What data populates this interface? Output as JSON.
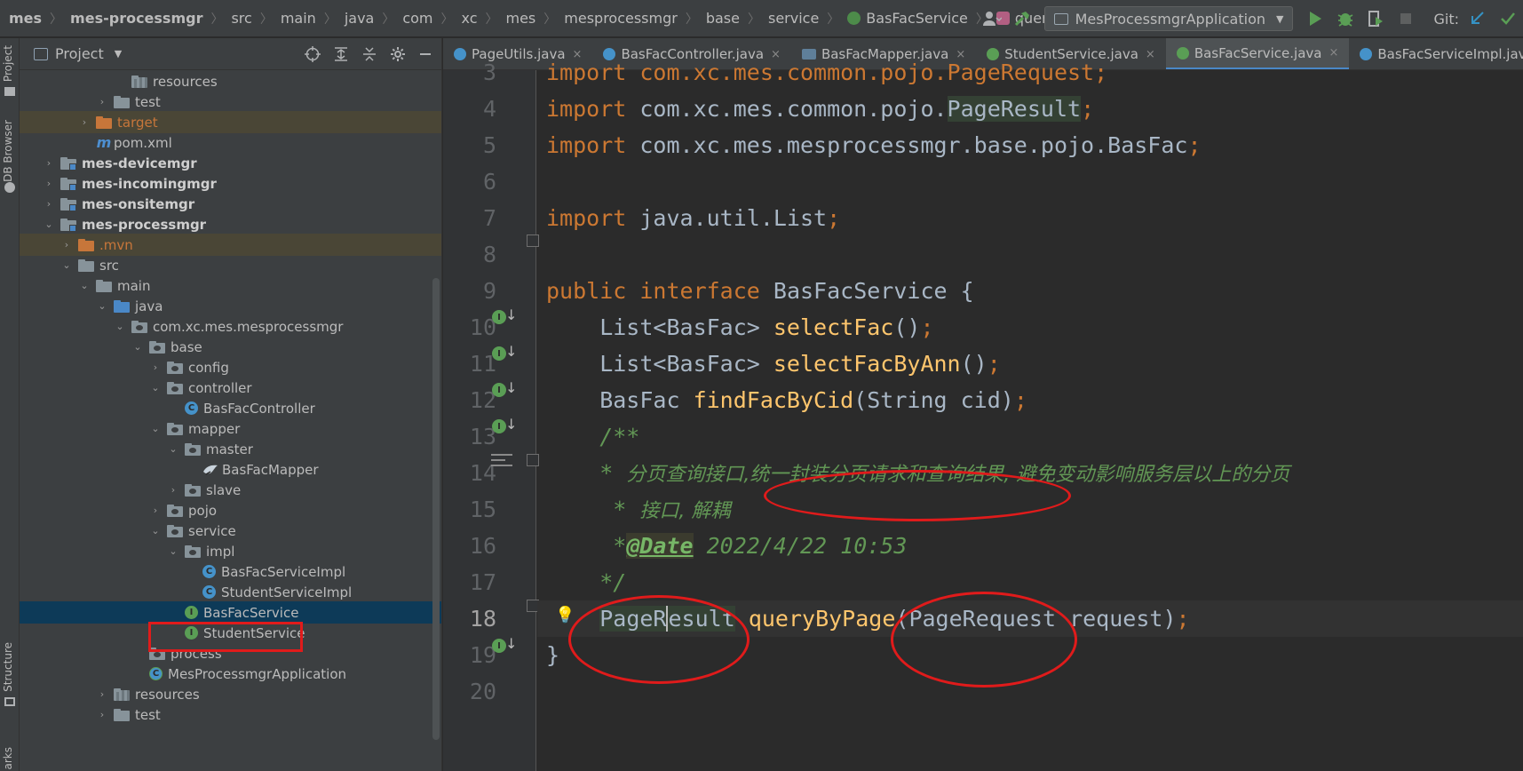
{
  "breadcrumb": [
    "mes",
    "mes-processmgr",
    "src",
    "main",
    "java",
    "com",
    "xc",
    "mes",
    "mesprocessmgr",
    "base",
    "service",
    "BasFacService",
    "queryByPage"
  ],
  "toolbar": {
    "run_config": "MesProcessmgrApplication",
    "git_label": "Git:"
  },
  "left_strip": {
    "project_tab": "Project",
    "db_browser_tab": "DB Browser",
    "structure_tab": "Structure",
    "bookmarks_tab": "arks"
  },
  "project_panel": {
    "title": "Project",
    "tree": [
      {
        "label": "resources",
        "indent": 5,
        "type": "res",
        "arrow": ""
      },
      {
        "label": "test",
        "indent": 4,
        "type": "folder",
        "arrow": "›"
      },
      {
        "label": "target",
        "indent": 3,
        "type": "orange",
        "arrow": "›",
        "highlight": "brown"
      },
      {
        "label": "pom.xml",
        "indent": 3,
        "type": "maven",
        "arrow": ""
      },
      {
        "label": "mes-devicemgr",
        "indent": 1,
        "type": "module",
        "arrow": "›",
        "bold": true
      },
      {
        "label": "mes-incomingmgr",
        "indent": 1,
        "type": "module",
        "arrow": "›",
        "bold": true
      },
      {
        "label": "mes-onsitemgr",
        "indent": 1,
        "type": "module",
        "arrow": "›",
        "bold": true
      },
      {
        "label": "mes-processmgr",
        "indent": 1,
        "type": "module",
        "arrow": "⌄",
        "bold": true
      },
      {
        "label": ".mvn",
        "indent": 2,
        "type": "orange",
        "arrow": "›",
        "highlight": "brown"
      },
      {
        "label": "src",
        "indent": 2,
        "type": "folder",
        "arrow": "⌄"
      },
      {
        "label": "main",
        "indent": 3,
        "type": "folder",
        "arrow": "⌄"
      },
      {
        "label": "java",
        "indent": 4,
        "type": "blue",
        "arrow": "⌄"
      },
      {
        "label": "com.xc.mes.mesprocessmgr",
        "indent": 5,
        "type": "pkg",
        "arrow": "⌄"
      },
      {
        "label": "base",
        "indent": 6,
        "type": "pkg",
        "arrow": "⌄"
      },
      {
        "label": "config",
        "indent": 7,
        "type": "pkg",
        "arrow": "›"
      },
      {
        "label": "controller",
        "indent": 7,
        "type": "pkg",
        "arrow": "⌄"
      },
      {
        "label": "BasFacController",
        "indent": 8,
        "type": "class",
        "arrow": ""
      },
      {
        "label": "mapper",
        "indent": 7,
        "type": "pkg",
        "arrow": "⌄"
      },
      {
        "label": "master",
        "indent": 8,
        "type": "pkg",
        "arrow": "⌄"
      },
      {
        "label": "BasFacMapper",
        "indent": 9,
        "type": "mapper",
        "arrow": ""
      },
      {
        "label": "slave",
        "indent": 8,
        "type": "pkg",
        "arrow": "›"
      },
      {
        "label": "pojo",
        "indent": 7,
        "type": "pkg",
        "arrow": "›"
      },
      {
        "label": "service",
        "indent": 7,
        "type": "pkg",
        "arrow": "⌄"
      },
      {
        "label": "impl",
        "indent": 8,
        "type": "pkg",
        "arrow": "⌄"
      },
      {
        "label": "BasFacServiceImpl",
        "indent": 9,
        "type": "class",
        "arrow": ""
      },
      {
        "label": "StudentServiceImpl",
        "indent": 9,
        "type": "class",
        "arrow": ""
      },
      {
        "label": "BasFacService",
        "indent": 8,
        "type": "interface",
        "arrow": "",
        "selected": true
      },
      {
        "label": "StudentService",
        "indent": 8,
        "type": "interface",
        "arrow": ""
      },
      {
        "label": "process",
        "indent": 6,
        "type": "pkg",
        "arrow": ""
      },
      {
        "label": "MesProcessmgrApplication",
        "indent": 6,
        "type": "app",
        "arrow": ""
      },
      {
        "label": "resources",
        "indent": 4,
        "type": "res",
        "arrow": "›"
      },
      {
        "label": "test",
        "indent": 4,
        "type": "folder",
        "arrow": "›"
      }
    ]
  },
  "tabs": [
    {
      "label": "PageUtils.java",
      "icon": "class-icon",
      "active": false
    },
    {
      "label": "BasFacController.java",
      "icon": "class-icon",
      "active": false
    },
    {
      "label": "BasFacMapper.java",
      "icon": "mapper-icon",
      "active": false
    },
    {
      "label": "StudentService.java",
      "icon": "interface-icon",
      "active": false
    },
    {
      "label": "BasFacService.java",
      "icon": "interface-icon",
      "active": true
    },
    {
      "label": "BasFacServiceImpl.java",
      "icon": "class-icon",
      "active": false
    }
  ],
  "editor": {
    "line_numbers": [
      "3",
      "4",
      "5",
      "6",
      "7",
      "8",
      "9",
      "10",
      "11",
      "12",
      "13",
      "14",
      "15",
      "16",
      "17",
      "18",
      "19",
      "20"
    ],
    "current_line": "18",
    "code": {
      "l3": "import com.xc.mes.common.pojo.PageRequest;",
      "l4_kw": "import",
      "l4_pkg": " com.xc.mes.common.pojo.",
      "l4_cls": "PageResult",
      "l5_kw": "import",
      "l5_pkg": " com.xc.mes.mesprocessmgr.base.pojo.BasFac",
      "l7_kw": "import",
      "l7_pkg": " java.util.List",
      "l9_kw1": "public",
      "l9_kw2": "interface",
      "l9_rest": " BasFacService {",
      "l10_type": "    List<BasFac> ",
      "l10_fn": "selectFac",
      "l10_args": "()",
      "l11_type": "    List<BasFac> ",
      "l11_fn": "selectFacByAnn",
      "l11_args": "()",
      "l12_type": "    BasFac ",
      "l12_fn": "findFacByCid",
      "l12_args": "(String cid)",
      "l13": "    /**",
      "l14_star": "    * ",
      "l14_text": "分页查询接口,统一封装分页请求和查询结果, 避免变动影响服务层以上的分页",
      "l15_star": "     * ",
      "l15_text": "接口, 解耦",
      "l16_star": "     *",
      "l16_tag": "@Date",
      "l16_text": " 2022/4/22 10:53",
      "l17": "    */",
      "l18_type_a": "PageR",
      "l18_type_b": "esult",
      "l18_fn": "queryByPage",
      "l18_param_type": "PageRequest",
      "l18_param": " request)",
      "l19": "}",
      "semicolon": ";"
    }
  },
  "colors": {
    "keyword": "#cc7832",
    "function": "#ffc66d",
    "comment": "#629755",
    "annotation_red": "#e01b1b",
    "selection": "#0d3a58"
  }
}
